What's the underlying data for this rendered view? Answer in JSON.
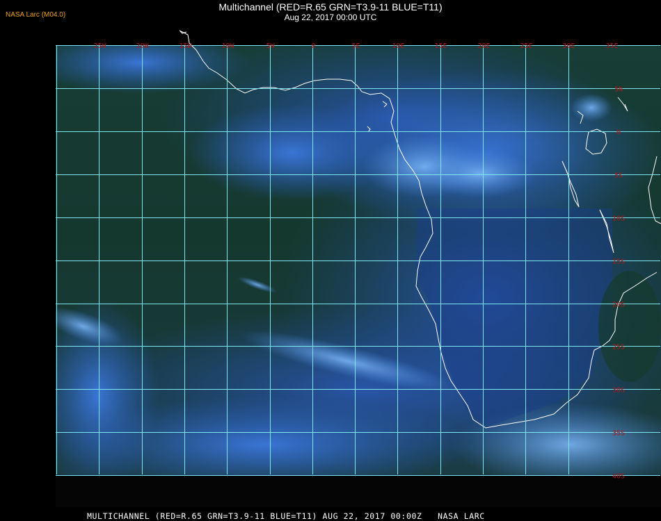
{
  "header": {
    "credit": "NASA Larc (M04.0)",
    "title": "Multichannel (RED=R.65 GRN=T3.9-11 BLUE=T11)",
    "subtitle": "Aug 22, 2017 00:00 UTC"
  },
  "footer": {
    "caption": "MULTICHANNEL (RED=R.65 GRN=T3.9-11 BLUE=T11) AUG 22, 2017 00:00Z   NASA LARC"
  },
  "map": {
    "longitude_labels": [
      "25W",
      "20W",
      "15W",
      "10W",
      "5W",
      "0",
      "5E",
      "10E",
      "15E",
      "20E",
      "25E",
      "30E",
      "35E"
    ],
    "latitude_labels": [
      "5N",
      "0",
      "5S",
      "10S",
      "15S",
      "20S",
      "25S",
      "30S",
      "35S",
      "40S"
    ],
    "colors": {
      "grid": "#7fe6f0",
      "coastline": "#ffffff",
      "label": "#b01818",
      "ocean_dark": "#16362a",
      "cloud": "#2a62c8",
      "cloud_bright": "#6aa8f0"
    }
  }
}
